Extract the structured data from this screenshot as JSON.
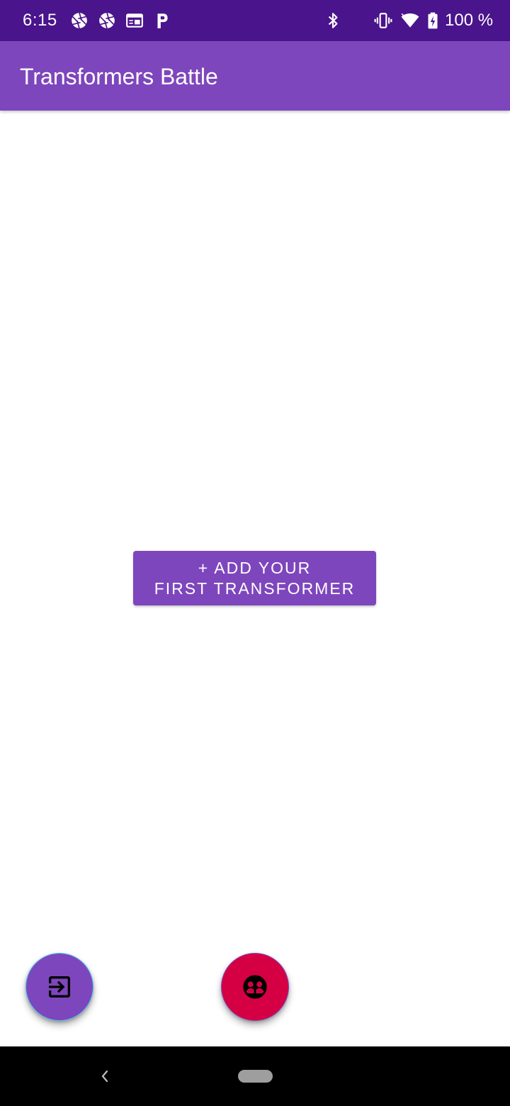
{
  "status_bar": {
    "time": "6:15",
    "battery_text": "100 %",
    "icons": [
      "aperture-icon",
      "aperture-icon",
      "calendar-icon",
      "parking-icon",
      "bluetooth-icon",
      "vibrate-icon",
      "wifi-icon",
      "battery-charging-icon"
    ],
    "background_color": "#4a148c"
  },
  "app_bar": {
    "title": "Transformers Battle",
    "background_color": "#7e46bc"
  },
  "main": {
    "add_button": {
      "line1": "+ ADD YOUR",
      "line2": "FIRST TRANSFORMER",
      "background_color": "#7e46bc"
    }
  },
  "fabs": {
    "exit": {
      "icon": "exit-to-app-icon",
      "background_color": "#7e46bc"
    },
    "battle": {
      "icon": "group-icon",
      "background_color": "#d50044"
    }
  },
  "nav_bar": {
    "icons": [
      "back-chevron-icon",
      "home-pill-icon"
    ]
  }
}
